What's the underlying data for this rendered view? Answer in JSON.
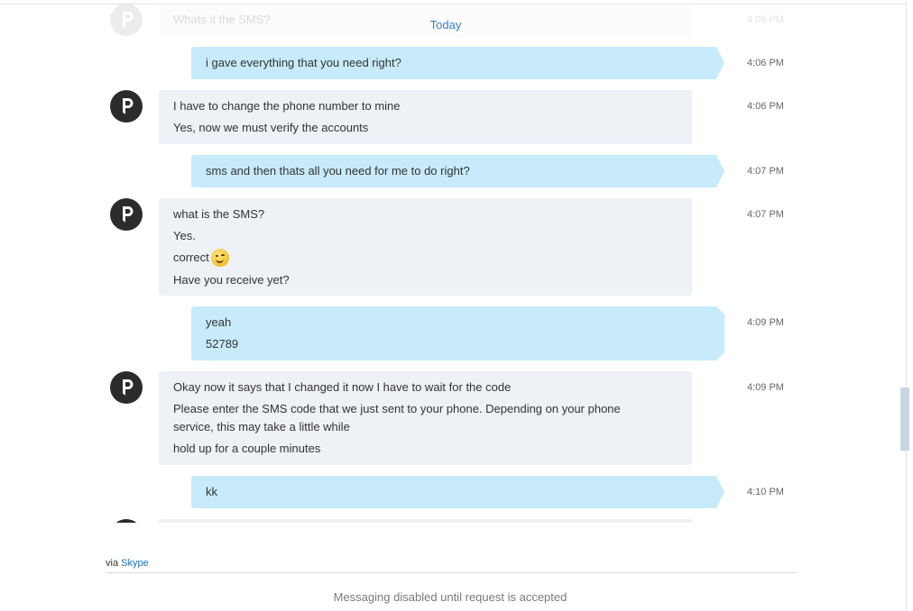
{
  "conversation": {
    "date_divider": "Today",
    "faded_message": {
      "text": "Whats it the SMS?",
      "time": "4:06 PM"
    },
    "messages": [
      {
        "direction": "out",
        "lines": [
          "i gave everything that you need right?"
        ],
        "time": "4:06 PM"
      },
      {
        "direction": "in",
        "lines": [
          "I have to change the phone number to mine",
          "Yes, now we must verify the accounts"
        ],
        "time": "4:06 PM"
      },
      {
        "direction": "out",
        "lines": [
          "sms and then thats all you need for me to do right?"
        ],
        "time": "4:07 PM"
      },
      {
        "direction": "in",
        "lines": [
          "what is the SMS?",
          "Yes.",
          "correct",
          "Have you receive yet?"
        ],
        "emoticon": "winking-smiley-emoticon",
        "time": "4:07 PM"
      },
      {
        "direction": "out",
        "lines": [
          "yeah",
          "52789"
        ],
        "time": "4:09 PM"
      },
      {
        "direction": "in",
        "lines": [
          "Okay now it says that I changed it now I have to wait for the code",
          "Please enter the SMS code that we just sent to your phone. Depending on your phone service, this may take a little while",
          "hold up for a couple minutes"
        ],
        "time": "4:09 PM"
      },
      {
        "direction": "out",
        "lines": [
          "kk"
        ],
        "time": "4:10 PM"
      }
    ]
  },
  "footer": {
    "via_prefix": "via",
    "via_link": "Skype",
    "disabled_note": "Messaging disabled until request is accepted"
  },
  "colors": {
    "incoming_bubble": "#eef1f6",
    "outgoing_bubble": "#c7ebfb",
    "link": "#1b73c4",
    "avatar": "#2b2b2b"
  },
  "icons": {
    "avatar": "letter-p-avatar-icon",
    "emoticon": "winking-smiley-emoticon"
  }
}
